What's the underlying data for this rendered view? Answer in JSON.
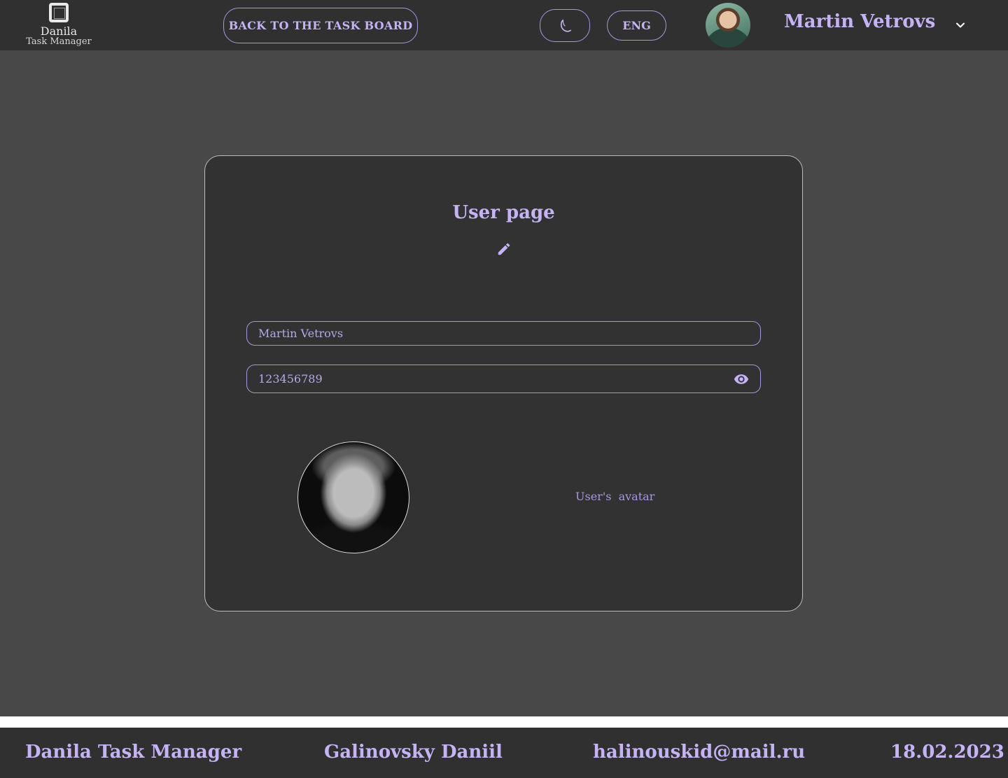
{
  "colors": {
    "accent": "#c5b3f6",
    "header_bg": "#303030",
    "page_bg": "#484848",
    "card_bg": "#323232"
  },
  "header": {
    "logo": {
      "title": "Danila",
      "subtitle": "Task Manager",
      "icon": "window-icon"
    },
    "back_button_label": "BACK TO THE TASK BOARD",
    "theme_toggle_icon": "moon-icon",
    "language_label": "ENG",
    "user_name": "Martin Vetrovs",
    "menu_icon": "chevron-down-icon"
  },
  "user_page": {
    "title": "User page",
    "edit_icon": "pencil-icon",
    "name_field_value": "Martin Vetrovs",
    "password_field_value": "123456789",
    "password_toggle_icon": "eye-icon",
    "avatar_label": "User's  avatar"
  },
  "footer": {
    "app_name": "Danila Task Manager",
    "author": "Galinovsky Daniil",
    "email": "halinouskid@mail.ru",
    "date": "18.02.2023"
  }
}
